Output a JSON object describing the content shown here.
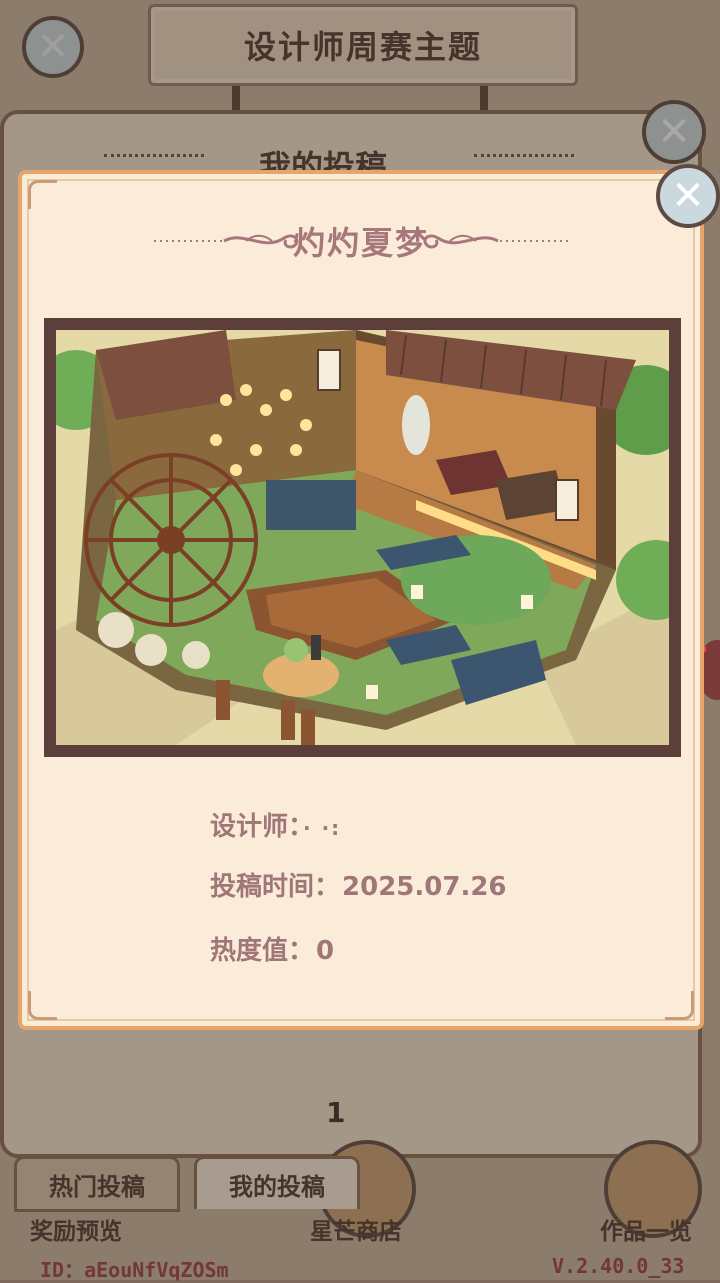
{
  "header": {
    "title": "设计师周赛主题"
  },
  "panel": {
    "heading": "我的投稿",
    "page_number": "1"
  },
  "tabs": [
    {
      "label": "热门投稿"
    },
    {
      "label": "我的投稿"
    }
  ],
  "bottom_nav": {
    "reward_preview": "奖励预览",
    "star_shop": "星芒商店",
    "works_overview": "作品一览"
  },
  "footer": {
    "id": "ID：aEouNfVqZOSm",
    "version": "V.2.40.0_33"
  },
  "modal": {
    "title": "灼灼夏梦",
    "designer_label": "设计师：",
    "designer_value": "·        ·:",
    "time_label": "投稿时间：",
    "time_value": "2025.07.26",
    "heat_label": "热度值：",
    "heat_value": "0"
  },
  "icons": {
    "back": "close-x-icon",
    "close": "close-x-icon"
  },
  "colors": {
    "accent_border": "#e8a56a",
    "title_text": "#a7787b",
    "info_text": "#a07779",
    "frame": "#5c3f3a"
  }
}
